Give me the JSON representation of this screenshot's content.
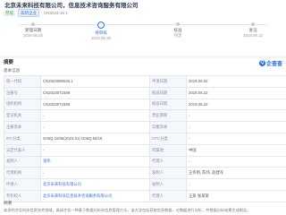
{
  "header": {
    "title": "北京未来科技有限公司，信息技术咨询服务有限公司",
    "tags": [
      {
        "label": "存续",
        "style": "green"
      },
      {
        "label": "高新企业",
        "style": "blue"
      },
      {
        "label": "CN2023-15 1",
        "style": "plain"
      }
    ]
  },
  "timeline": [
    {
      "label": "",
      "status": "受理日期",
      "date": "2019.05.02",
      "active": false
    },
    {
      "label": "",
      "status": "待审核",
      "date": "2019.06.26",
      "active": true
    },
    {
      "label": "",
      "status": "核准",
      "date": "待定",
      "active": false
    },
    {
      "label": "",
      "status": "发证",
      "date": "2019.08.12",
      "active": false
    }
  ],
  "details": {
    "title": "摘要",
    "brand": "企查查",
    "section_label": "基本信息",
    "rows": [
      {
        "k1": "统一代码",
        "v1": "CN2023096025.1",
        "k2": "申请日期",
        "v2": "2019.05.02"
      },
      {
        "k1": "注册号",
        "v1": "CN2023071589",
        "k2": "核准日期",
        "v2": "2019.06.22"
      },
      {
        "k1": "组织机构",
        "v1": "CN2023071590",
        "k2": "核准日期",
        "v2": "2019.06.22"
      },
      {
        "k1": "登记机关",
        "v1": "-",
        "k2": "营业期限",
        "v2": "-"
      },
      {
        "k1": "注册资本",
        "v1": "-",
        "k2": "实缴资本",
        "v2": "-"
      },
      {
        "k1": "IPC分类",
        "v1": "G06Q 10/06(2023.01) G06Q 50/18",
        "k2": "CPC分类",
        "v2": "-"
      },
      {
        "k1": "法定代表人",
        "v1": "-",
        "k2": "所属地",
        "v2": "中国"
      },
      {
        "k1": "发明人",
        "v1": "张伟",
        "k2": "代理人",
        "v2": "-"
      },
      {
        "k1": "代理机构",
        "v1": "-",
        "k2": "发明人",
        "v2": "王伟明, 陈伟, 赵建军"
      },
      {
        "k1": "申请人",
        "v1": "北京未来科技有限公司",
        "k2": "发明人",
        "v2": "-"
      },
      {
        "k1": "专利权人",
        "v1": "北京未来科技信息技术咨询服务有限公司",
        "k2": "代理人",
        "v2": "王某 张某某"
      }
    ],
    "scope_title": "摘要",
    "scope_text": "本发明涉及科技信息技术领域，具体涉及一种基于数据分析的信息管理方法，该方法包括获取信息数据，对数据进行分析，并根据分析结果生成报告。"
  }
}
